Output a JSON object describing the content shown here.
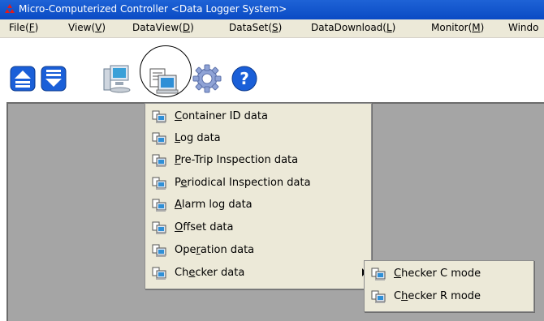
{
  "window": {
    "title": "Micro-Computerized Controller <Data Logger System>"
  },
  "menubar": {
    "items": [
      {
        "label": "File(",
        "key": "F",
        "suffix": ")"
      },
      {
        "label": "View(",
        "key": "V",
        "suffix": ")"
      },
      {
        "label": "DataView(",
        "key": "D",
        "suffix": ")"
      },
      {
        "label": "DataSet(",
        "key": "S",
        "suffix": ")"
      },
      {
        "label": "DataDownload(",
        "key": "L",
        "suffix": ")"
      },
      {
        "label": "Monitor(",
        "key": "M",
        "suffix": ")"
      },
      {
        "label": "Windo",
        "key": "",
        "suffix": ""
      }
    ]
  },
  "toolbar": {
    "icons": [
      "upload-icon",
      "download-icon",
      "monitor-icon",
      "data-view-icon",
      "settings-gear-icon",
      "help-icon"
    ]
  },
  "dataview_menu": {
    "items": [
      {
        "label": "Container ID data",
        "underline_index": 0
      },
      {
        "label": "Log data",
        "underline_index": 0
      },
      {
        "label": "Pre-Trip Inspection data",
        "underline_index": 0
      },
      {
        "label": "Periodical Inspection data",
        "underline_index": 1
      },
      {
        "label": "Alarm log data",
        "underline_index": 0
      },
      {
        "label": "Offset data",
        "underline_index": 0
      },
      {
        "label": "Operation data",
        "underline_index": 3
      },
      {
        "label": "Checker data",
        "underline_index": 2,
        "has_submenu": true
      }
    ]
  },
  "checker_submenu": {
    "items": [
      {
        "label": "Checker C mode",
        "underline_index": 0
      },
      {
        "label": "Checker R mode",
        "underline_index": 1
      }
    ]
  },
  "colors": {
    "titlebar": "#0a4ac4",
    "menubar": "#ece9d8",
    "workspace": "#a5a5a5"
  }
}
